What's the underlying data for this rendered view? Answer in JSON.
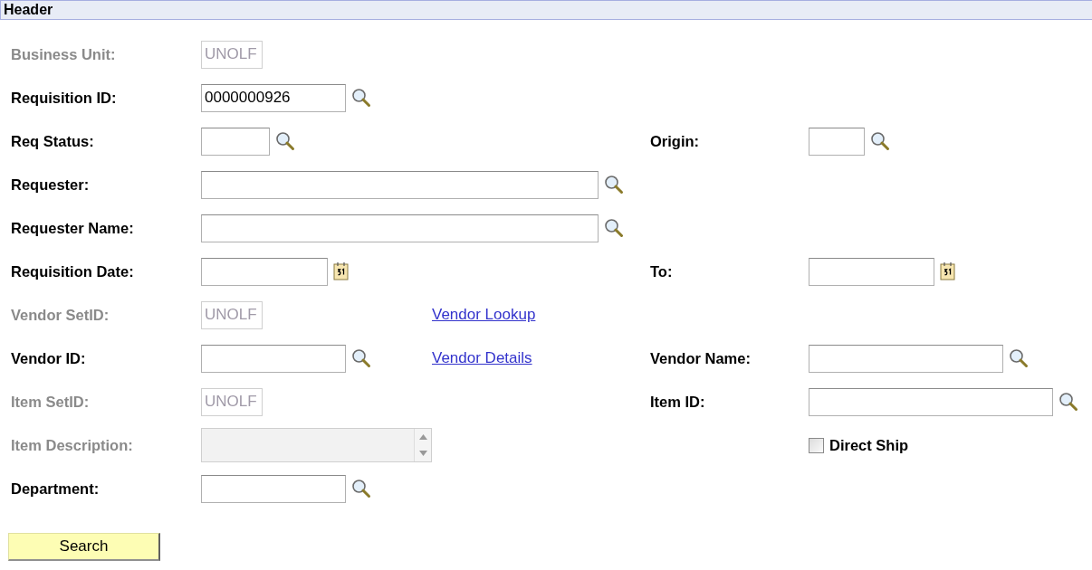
{
  "section": {
    "title": "Header"
  },
  "rows": [
    {
      "left": {
        "label": "Business Unit:",
        "disabled": true,
        "value": "UNOLF",
        "kind": "plain"
      }
    },
    {
      "left": {
        "label": "Requisition ID:",
        "disabled": false,
        "value": "0000000926",
        "kind": "search"
      }
    },
    {
      "left": {
        "label": "Req Status:",
        "disabled": false,
        "kind": "search"
      },
      "right": {
        "label": "Origin:",
        "disabled": false,
        "kind": "search"
      }
    },
    {
      "left": {
        "label": "Requester:",
        "disabled": false,
        "kind": "search"
      }
    },
    {
      "left": {
        "label": "Requester Name:",
        "disabled": false,
        "kind": "search"
      }
    },
    {
      "left": {
        "label": "Requisition Date:",
        "disabled": false,
        "kind": "calendar"
      },
      "right": {
        "label": "To:",
        "disabled": false,
        "kind": "calendar"
      }
    },
    {
      "left": {
        "label": "Vendor SetID:",
        "disabled": true,
        "value": "UNOLF",
        "kind": "plain"
      },
      "link": "Vendor Lookup"
    },
    {
      "left": {
        "label": "Vendor ID:",
        "disabled": false,
        "kind": "search"
      },
      "link": "Vendor Details",
      "right": {
        "label": "Vendor Name:",
        "disabled": false,
        "kind": "search"
      }
    },
    {
      "left": {
        "label": "Item SetID:",
        "disabled": true,
        "value": "UNOLF",
        "kind": "plain"
      },
      "right": {
        "label": "Item ID:",
        "disabled": false,
        "kind": "search"
      }
    },
    {
      "left": {
        "label": "Item Description:",
        "disabled": true,
        "kind": "textarea"
      },
      "checkbox": {
        "label": "Direct Ship",
        "checked": false
      }
    },
    {
      "left": {
        "label": "Department:",
        "disabled": false,
        "kind": "search"
      }
    }
  ],
  "search_button": "Search"
}
